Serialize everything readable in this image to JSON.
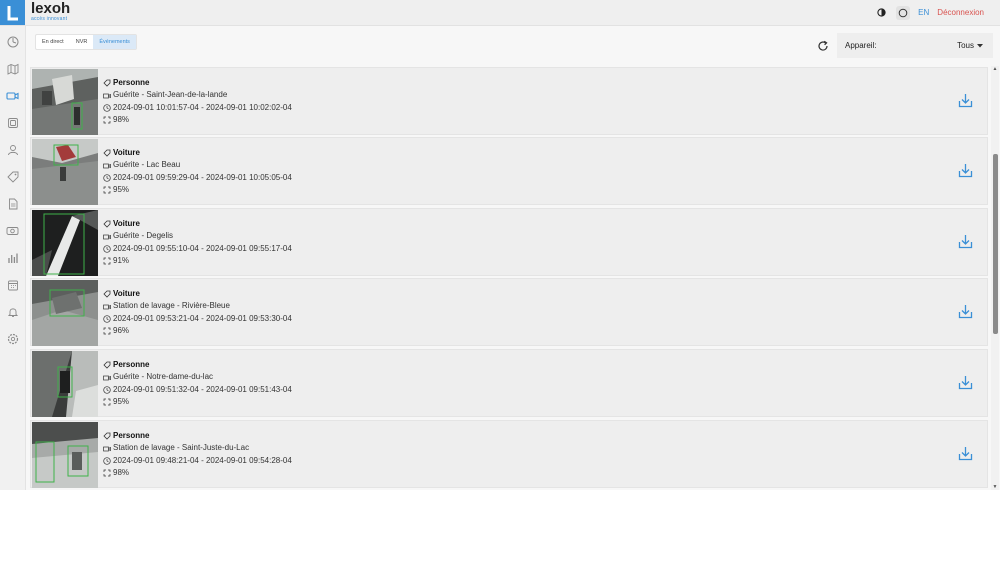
{
  "brand": {
    "name": "lexoh",
    "tagline": "accès innovant",
    "accent": "#3a8fd6"
  },
  "header": {
    "lang": "EN",
    "logout": "Déconnexion"
  },
  "sidebar": {
    "icons": [
      "dashboard-icon",
      "map-icon",
      "camera-icon",
      "device-icon",
      "user-icon",
      "tag-icon",
      "document-icon",
      "plate-icon",
      "stats-icon",
      "calendar-icon",
      "bell-icon",
      "settings-icon"
    ]
  },
  "tabs": [
    {
      "label": "En direct",
      "active": false
    },
    {
      "label": "NVR",
      "active": false
    },
    {
      "label": "Événements",
      "active": true
    }
  ],
  "filter": {
    "label": "Appareil:",
    "value": "Tous"
  },
  "events": [
    {
      "type": "Personne",
      "camera": "Guérite - Saint-Jean-de-la-lande",
      "time": "2024-09-01 10:01:57-04 - 2024-09-01 10:02:02-04",
      "confidence": "98%"
    },
    {
      "type": "Voiture",
      "camera": "Guérite - Lac Beau",
      "time": "2024-09-01 09:59:29-04 - 2024-09-01 10:05:05-04",
      "confidence": "95%"
    },
    {
      "type": "Voiture",
      "camera": "Guérite - Degelis",
      "time": "2024-09-01 09:55:10-04 - 2024-09-01 09:55:17-04",
      "confidence": "91%"
    },
    {
      "type": "Voiture",
      "camera": "Station de lavage - Rivière-Bleue",
      "time": "2024-09-01 09:53:21-04 - 2024-09-01 09:53:30-04",
      "confidence": "96%"
    },
    {
      "type": "Personne",
      "camera": "Guérite - Notre-dame-du-lac",
      "time": "2024-09-01 09:51:32-04 - 2024-09-01 09:51:43-04",
      "confidence": "95%"
    },
    {
      "type": "Personne",
      "camera": "Station de lavage - Saint-Juste-du-Lac",
      "time": "2024-09-01 09:48:21-04 - 2024-09-01 09:54:28-04",
      "confidence": "98%"
    }
  ]
}
